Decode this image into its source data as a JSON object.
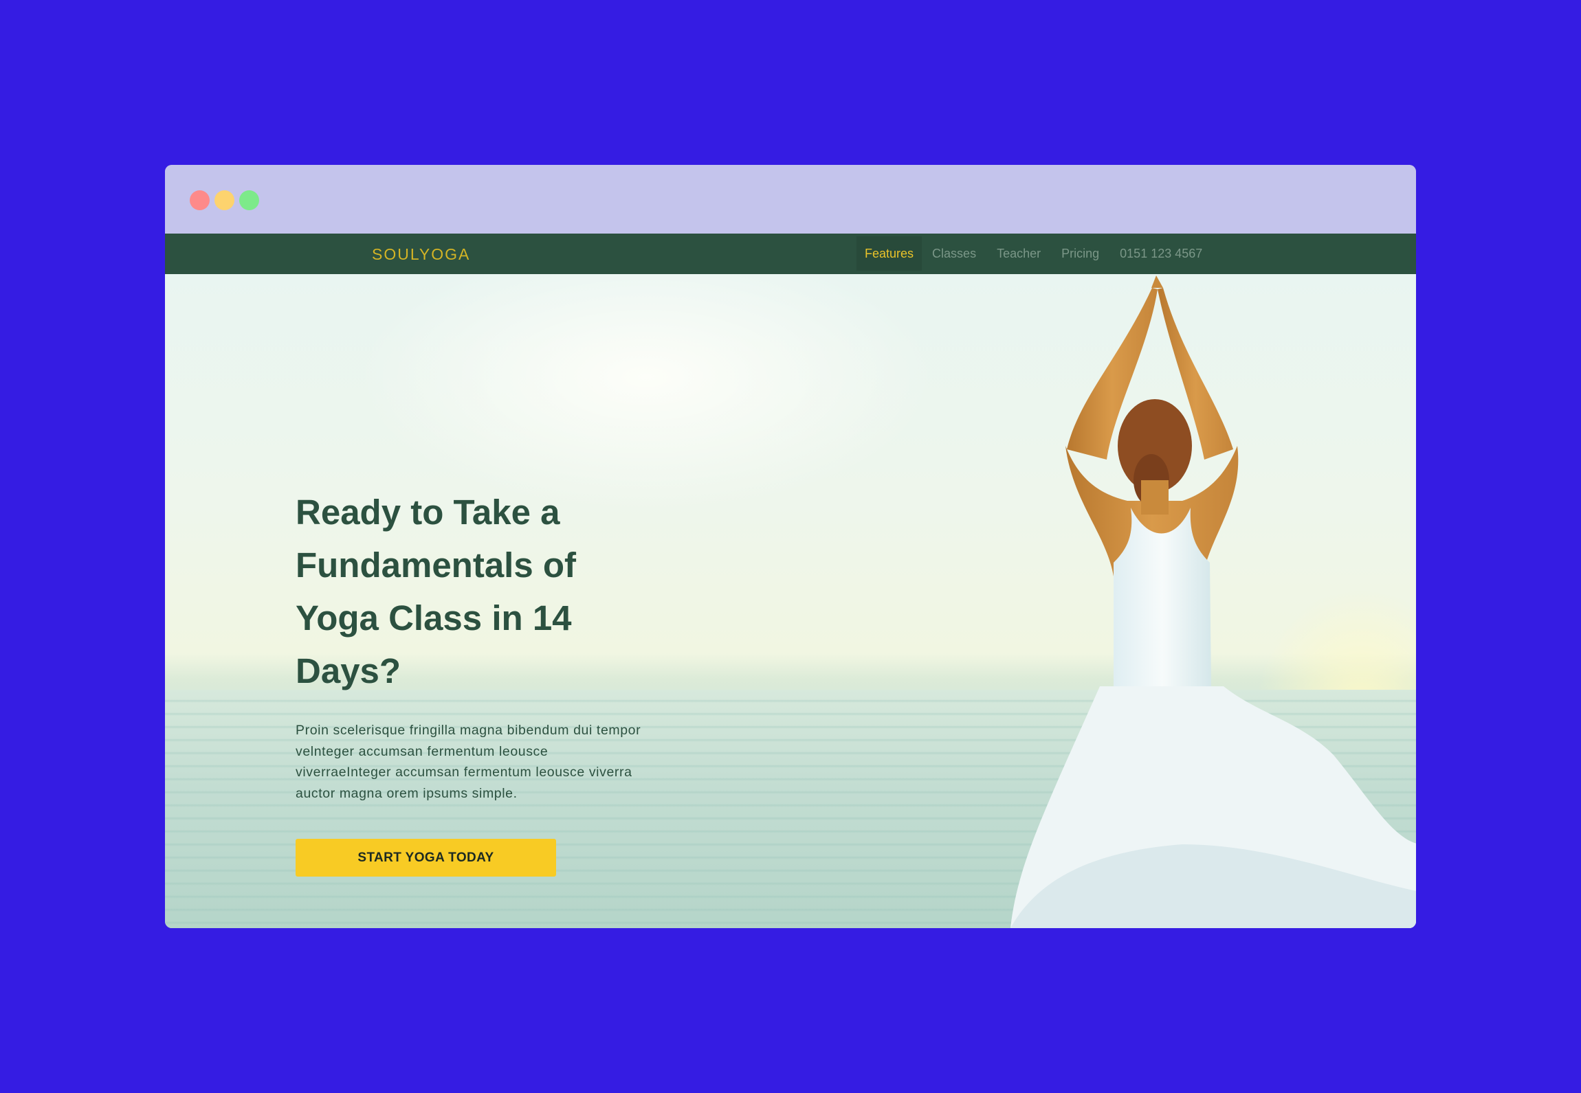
{
  "browser": {
    "controls": [
      "close",
      "minimize",
      "maximize"
    ]
  },
  "navbar": {
    "brand": "SOULYOGA",
    "items": [
      {
        "label": "Features",
        "active": true
      },
      {
        "label": "Classes",
        "active": false
      },
      {
        "label": "Teacher",
        "active": false
      },
      {
        "label": "Pricing",
        "active": false
      },
      {
        "label": "0151 123 4567",
        "active": false
      }
    ]
  },
  "hero": {
    "headline": "Ready to Take a Fundamentals of Yoga Class in 14 Days?",
    "description": "Proin scelerisque fringilla magna bibendum dui tempor velnteger accumsan fermentum leousce viverraeInteger accumsan fermentum leousce viverra auctor magna orem ipsums simple.",
    "cta_label": "START YOGA TODAY"
  },
  "colors": {
    "page_background": "#351ce3",
    "titlebar": "#c4c4ec",
    "navbar": "#2c5140",
    "brand": "#d4b425",
    "nav_active": "#e9c32a",
    "headline": "#2c5140",
    "cta": "#f8cb24"
  }
}
